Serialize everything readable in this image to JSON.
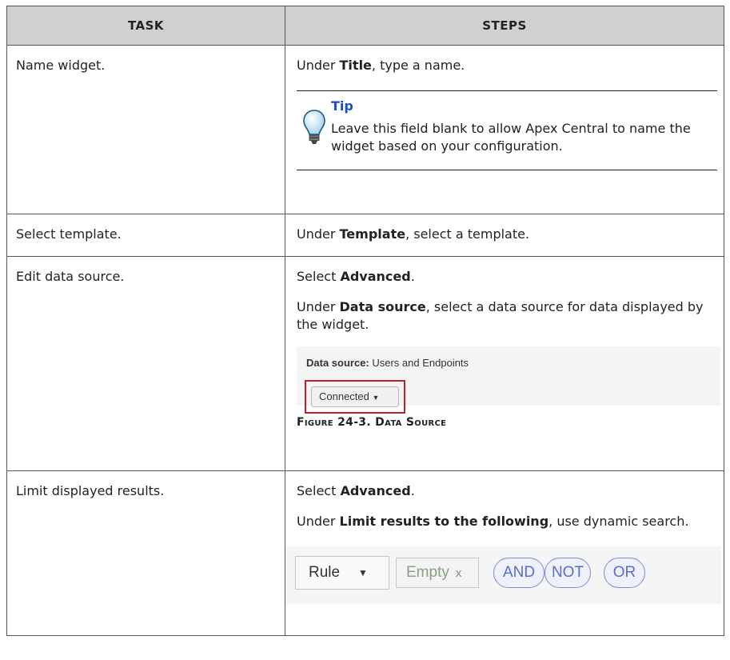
{
  "table": {
    "headers": {
      "task": "Task",
      "steps": "Steps"
    },
    "rows": [
      {
        "task": "Name widget.",
        "step1": {
          "pre": "Under ",
          "bold": "Title",
          "post": ", type a name."
        },
        "tip": {
          "title": "Tip",
          "text": "Leave this field blank to allow Apex Central to name the widget based on your configuration."
        }
      },
      {
        "task": "Select template.",
        "step1": {
          "pre": "Under ",
          "bold": "Template",
          "post": ", select a template."
        }
      },
      {
        "task": "Edit data source.",
        "step1": {
          "pre": "Select ",
          "bold": "Advanced",
          "post": "."
        },
        "step2": {
          "pre": "Under ",
          "bold": "Data source",
          "post": ", select a data source for data displayed by the widget."
        },
        "screenshot": {
          "label": "Data source:",
          "value": " Users and Endpoints",
          "button": "Connected"
        },
        "caption": "Figure 24-3. Data Source"
      },
      {
        "task": "Limit displayed results.",
        "step1": {
          "pre": "Select ",
          "bold": "Advanced",
          "post": "."
        },
        "step2": {
          "pre": "Under ",
          "bold": "Limit results to the following",
          "post": ", use dynamic search."
        },
        "search": {
          "rule": "Rule",
          "empty": "Empty",
          "remove": "x",
          "and": "AND",
          "not": "NOT",
          "or": "OR"
        }
      }
    ]
  },
  "colors": {
    "header_bg": "#d0d0d0",
    "tip_title": "#1a4fc8",
    "highlight": "#c0202a"
  }
}
